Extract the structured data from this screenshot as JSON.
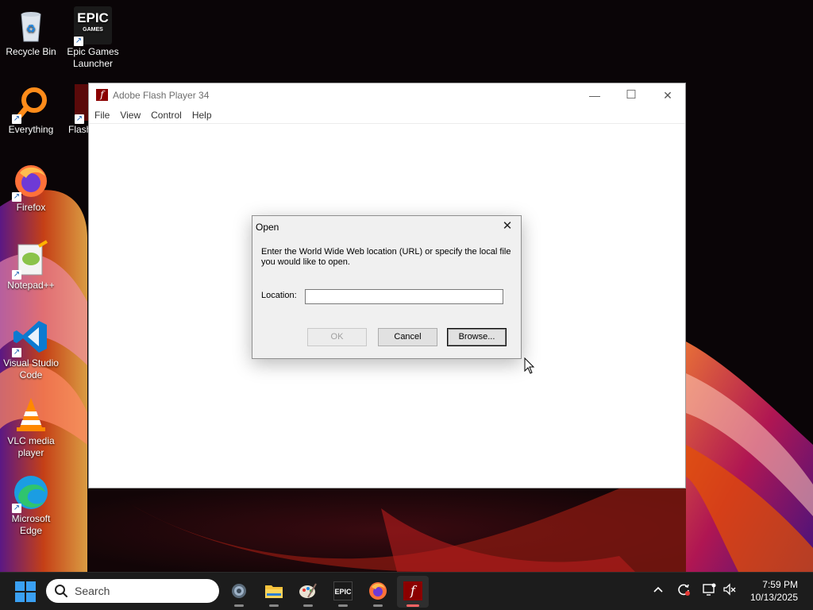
{
  "desktop": {
    "icons": [
      {
        "label": "Recycle Bin"
      },
      {
        "label": "Epic Games Launcher",
        "logo_text": "EPIC",
        "logo_sub": "GAMES"
      },
      {
        "label": "Everything"
      },
      {
        "label": "Flash"
      },
      {
        "label": "Firefox"
      },
      {
        "label": "Notepad++"
      },
      {
        "label": "Visual Studio Code"
      },
      {
        "label": "VLC media player"
      },
      {
        "label": "Microsoft Edge"
      }
    ]
  },
  "flash_window": {
    "title": "Adobe Flash Player 34",
    "title_icon": "f",
    "menu": [
      "File",
      "View",
      "Control",
      "Help"
    ],
    "controls": {
      "minimize": "—",
      "maximize": "☐",
      "close": "✕"
    }
  },
  "dialog": {
    "title": "Open",
    "close": "✕",
    "description": "Enter the World Wide Web location (URL) or specify the local file you would like to open.",
    "location_label": "Location:",
    "location_value": "",
    "buttons": {
      "ok": "OK",
      "cancel": "Cancel",
      "browse": "Browse..."
    }
  },
  "taskbar": {
    "search_placeholder": "Search",
    "epic_text": "EPIC",
    "clock_time": "7:59 PM",
    "clock_date": "10/13/2025"
  }
}
